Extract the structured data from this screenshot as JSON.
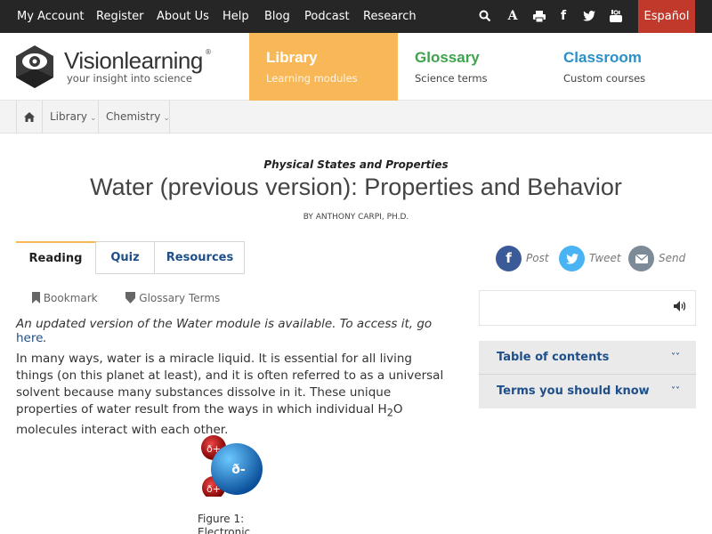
{
  "topnav": {
    "links": [
      "My Account",
      "Register",
      "About Us",
      "Help",
      "Blog",
      "Podcast",
      "Research"
    ],
    "icons": [
      "search-icon",
      "font-size-icon",
      "print-icon",
      "facebook-icon",
      "twitter-icon",
      "youtube-icon"
    ],
    "language": "Español"
  },
  "header": {
    "brand": "Visionlearning",
    "registered": "®",
    "tagline": "your insight into science",
    "sections": [
      {
        "title": "Library",
        "subtitle": "Learning modules"
      },
      {
        "title": "Glossary",
        "subtitle": "Science terms"
      },
      {
        "title": "Classroom",
        "subtitle": "Custom courses"
      }
    ]
  },
  "breadcrumb": [
    "Library",
    "Chemistry"
  ],
  "article": {
    "kicker": "Physical States and Properties",
    "title": "Water (previous version): Properties and Behavior",
    "byline": "BY ANTHONY CARPI, PH.D.",
    "tabs": [
      "Reading",
      "Quiz",
      "Resources"
    ],
    "share": [
      "Post",
      "Tweet",
      "Send"
    ],
    "tools": [
      "Bookmark",
      "Glossary Terms"
    ],
    "notice_text": "An updated version of the Water module is available. To access it, go ",
    "notice_link": "here",
    "notice_end": ".",
    "para": {
      "p1": "In many ways, water is a miracle ",
      "t1": "liquid",
      "p2": ". It is essential for all living things (on this planet at least), and it is often referred to as a ",
      "t2": "universal solvent",
      "p3": " because many substances dissolve in it. These unique properties of water result from the ways in which individual H",
      "sub": "2",
      "p4": "O ",
      "t3": "molecules",
      "p5": " interact with each other."
    },
    "figure": {
      "oxygen_label": "ð-",
      "hydrogen_label": "ð+",
      "caption": "Figure 1: Electronic"
    }
  },
  "sidebar": {
    "toc": "Table of contents",
    "terms": "Terms you should know"
  },
  "colors": {
    "library": "#f8b857",
    "glossary": "#3fa34d",
    "classroom": "#2b8fc8",
    "link": "#1f4f8a",
    "espanol": "#c0392b",
    "facebook": "#3b5a98",
    "twitter": "#4ab3f4",
    "email": "#7d8a97"
  }
}
